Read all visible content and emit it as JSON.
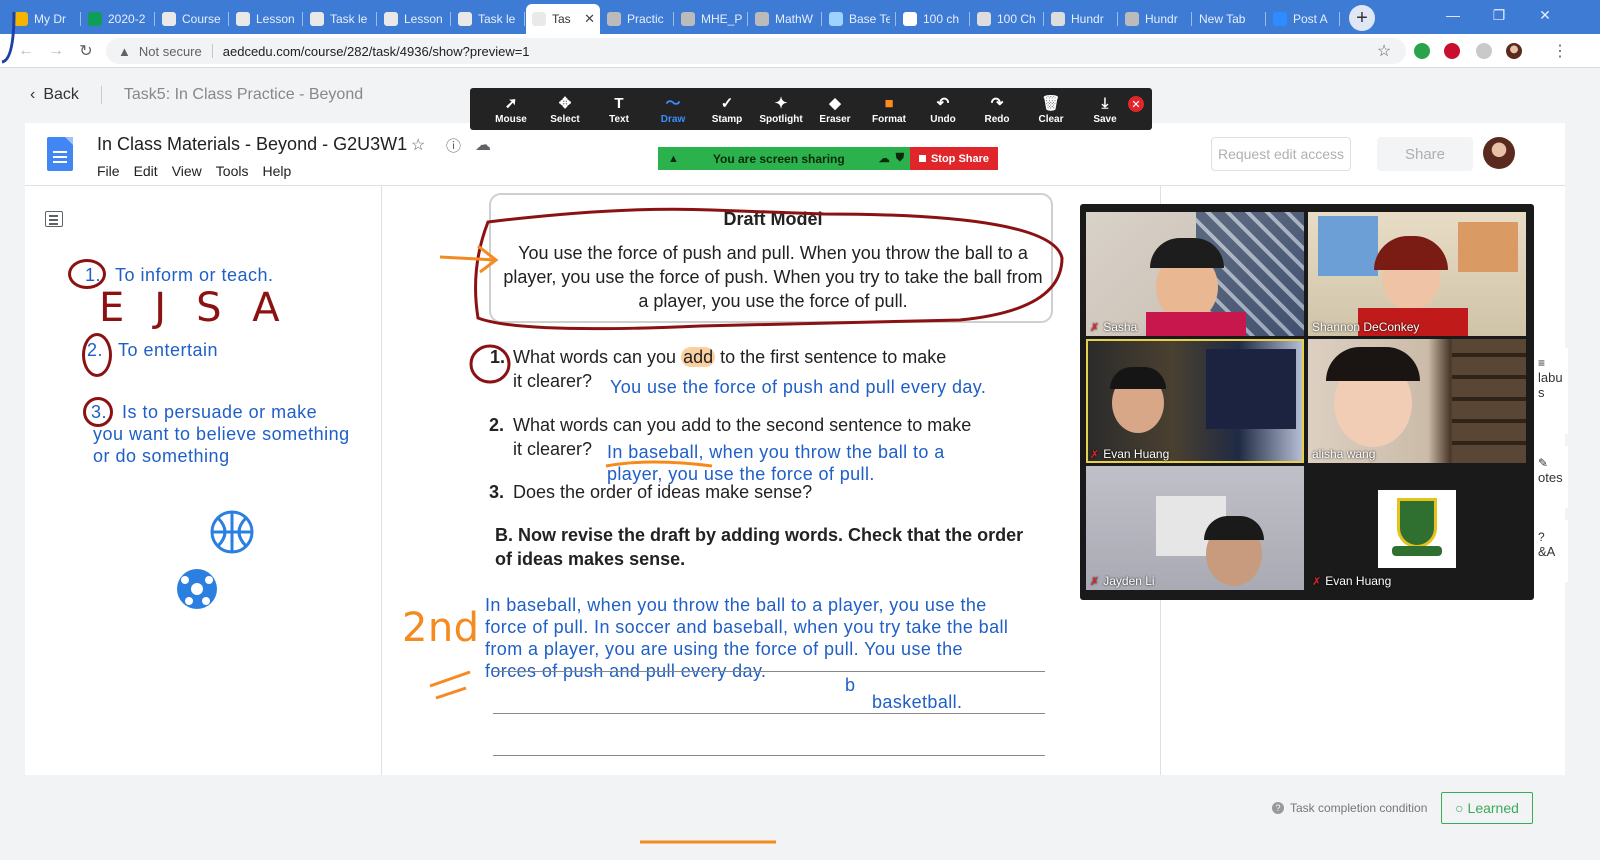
{
  "browser": {
    "tabs": [
      {
        "label": "My Dr",
        "icon": "drive-icon",
        "color": "#f4b400"
      },
      {
        "label": "2020-2",
        "icon": "sheets-icon",
        "color": "#0f9d58"
      },
      {
        "label": "Course",
        "icon": "classroom-icon",
        "color": "#e9e9e9"
      },
      {
        "label": "Lesson",
        "icon": "classroom-icon",
        "color": "#e9e9e9"
      },
      {
        "label": "Task le",
        "icon": "classroom-icon",
        "color": "#e9e9e9"
      },
      {
        "label": "Lesson",
        "icon": "classroom-icon",
        "color": "#e9e9e9"
      },
      {
        "label": "Task le",
        "icon": "classroom-icon",
        "color": "#e9e9e9"
      },
      {
        "label": "Tas",
        "icon": "classroom-icon",
        "color": "#e9e9e9",
        "active": true
      },
      {
        "label": "Practic",
        "icon": "globe-icon",
        "color": "#bbbbbb"
      },
      {
        "label": "MHE_P",
        "icon": "globe-icon",
        "color": "#bbbbbb"
      },
      {
        "label": "MathW",
        "icon": "globe-icon",
        "color": "#bbbbbb"
      },
      {
        "label": "Base Te",
        "icon": "toy-icon",
        "color": "#9fd3ff"
      },
      {
        "label": "100 ch",
        "icon": "google-icon",
        "color": "#ffffff"
      },
      {
        "label": "100 Ch",
        "icon": "printer-icon",
        "color": "#dddddd"
      },
      {
        "label": "Hundr",
        "icon": "printer-icon",
        "color": "#dddddd"
      },
      {
        "label": "Hundr",
        "icon": "globe-icon",
        "color": "#bbbbbb"
      },
      {
        "label": "New Tab",
        "icon": "",
        "color": ""
      },
      {
        "label": "Post A",
        "icon": "zoom-icon",
        "color": "#2d8cff"
      }
    ],
    "new_tab_symbol": "+",
    "not_secure": "Not secure",
    "url": "aedcedu.com/course/282/task/4936/show?preview=1"
  },
  "header": {
    "back_label": "Back",
    "breadcrumb": "Task5:  In Class Practice - Beyond"
  },
  "docs": {
    "title": "In Class Materials - Beyond - G2U3W1",
    "menu": [
      "File",
      "Edit",
      "View",
      "Tools",
      "Help"
    ],
    "request_edit": "Request edit access",
    "share": "Share"
  },
  "zoom": {
    "tools": [
      {
        "label": "Mouse",
        "glyph": "➚"
      },
      {
        "label": "Select",
        "glyph": "✥"
      },
      {
        "label": "Text",
        "glyph": "T"
      },
      {
        "label": "Draw",
        "glyph": "〜",
        "active": true
      },
      {
        "label": "Stamp",
        "glyph": "✓"
      },
      {
        "label": "Spotlight",
        "glyph": "✦"
      },
      {
        "label": "Eraser",
        "glyph": "◆"
      },
      {
        "label": "Format",
        "glyph": "■"
      },
      {
        "label": "Undo",
        "glyph": "↶"
      },
      {
        "label": "Redo",
        "glyph": "↷"
      },
      {
        "label": "Clear",
        "glyph": "🗑"
      },
      {
        "label": "Save",
        "glyph": "⤓"
      }
    ],
    "sharing_label": "You are screen sharing",
    "stop_share": "Stop Share",
    "participants": [
      "Sasha",
      "Shannon DeConkey",
      "Evan Huang",
      "alisha wang",
      "Jayden Li",
      "Evan Huang"
    ]
  },
  "left_notes": {
    "n1": "1.",
    "t1": "To inform or teach.",
    "letters": "EJSA",
    "n2": "2.",
    "t2": "To entertain",
    "n3": "3.",
    "t3a": "Is to persuade or make",
    "t3b": "you want to believe something",
    "t3c": "or do something"
  },
  "document": {
    "draft_title": "Draft Model",
    "draft_text": "You use the force of push and pull. When you throw the ball to a player, you use the force of push. When you try to take the ball from a player, you use the force of pull.",
    "q1_num": "1.",
    "q1_a": "What words can you",
    "q1_add": "add",
    "q1_b": "to the first sentence to make",
    "q1_c": "it clearer?",
    "a1": "You use the force of push and pull every day.",
    "q2_num": "2.",
    "q2_a": "What words can you add to the second sentence to make",
    "q2_b": "it clearer?",
    "a2a": "In baseball, when you throw the ball to a",
    "a2b": "player, you use the force of pull.",
    "q3_num": "3.",
    "q3": "Does the order of ideas make sense?",
    "partB_1": "B. Now revise the draft by adding words. Check that the order",
    "partB_2": "of ideas makes sense.",
    "ans_l1": "In baseball, when you throw the ball to a player, you use the",
    "ans_l2": "force of pull. In soccer and baseball, when you try take the ball",
    "ans_l3": "from a player, you are using the force of pull. You use the",
    "ans_l4": "forces of push and pull every day.",
    "ans_b": "b",
    "ans_basketball": "basketball.",
    "second_mark": "2nd"
  },
  "side_strip": {
    "s1": "labu",
    "s2": "s",
    "s3": "otes",
    "s4": "&A"
  },
  "footer": {
    "task_condition": "Task completion condition",
    "learned": "Learned"
  },
  "colors": {
    "zoom_blue": "#3b8cff",
    "share_green": "#2bb24c",
    "stop_red": "#e0262a",
    "ink_blue": "#1f5fc7",
    "ink_red": "#8a1212",
    "ink_orange": "#f58a1f"
  }
}
